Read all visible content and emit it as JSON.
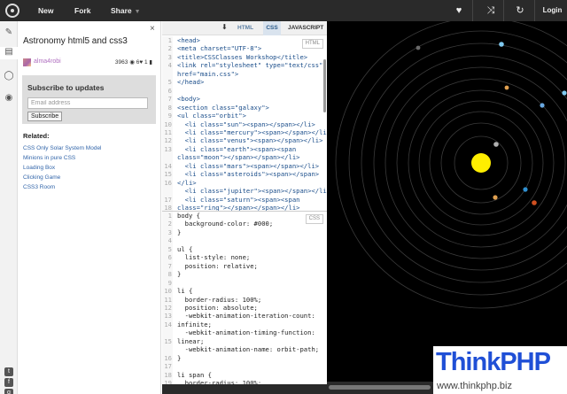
{
  "toolbar": {
    "new_label": "New",
    "fork_label": "Fork",
    "share_label": "Share",
    "share_caret": "▼",
    "login_label": "Login",
    "icons": [
      "logo-icon",
      "heart-icon",
      "shuffle-icon",
      "refresh-icon"
    ]
  },
  "strip": {
    "icons": [
      "wrench-icon",
      "document-icon",
      "comments-icon",
      "lightbulb-icon",
      "twitter-icon",
      "facebook-icon",
      "google-plus-icon"
    ]
  },
  "panel": {
    "close_label": "×",
    "title": "Astronomy html5 and css3",
    "author": "alma4robi",
    "views": "3963",
    "views_icon": "◉",
    "likes": "6",
    "likes_icon": "♥",
    "comments": "1",
    "comments_icon": "▮",
    "subscribe": {
      "title": "Subscribe to updates",
      "email_placeholder": "Email address",
      "button_label": "Subscribe"
    },
    "related_title": "Related:",
    "related": [
      "CSS Only Solar System Model",
      "Minions in pure CSS",
      "Loading Box",
      "Clicking Game",
      "CSS3 Room"
    ]
  },
  "editor": {
    "arrow_label": "⬇",
    "tabs": [
      "HTML",
      "CSS",
      "JAVASCRIPT"
    ],
    "active_tab": "CSS",
    "html_pane_label": "HTML",
    "css_pane_label": "CSS",
    "html_line_numbers": "1\n2\n3\n4\n\n5\n6\n7\n8\n9\n10\n11\n12\n13\n\n14\n15\n16\n\n17\n18\n19\n",
    "html_code_lines": [
      "<head>",
      "<meta charset=\"UTF-8\">",
      "<title>CSSClasses Workshop</title>",
      "<link rel=\"stylesheet\" type=\"text/css\"",
      "href=\"main.css\">",
      "</head>",
      "",
      "<body>",
      "<section class=\"galaxy\">",
      "<ul class=\"orbit\">",
      "  <li class=\"sun\"><span></span></li>",
      "  <li class=\"mercury\"><span></span></li>",
      "  <li class=\"venus\"><span></span></li>",
      "  <li class=\"earth\"><span><span",
      "class=\"moon\"></span></span></li>",
      "  <li class=\"mars\"><span></span></li>",
      "  <li class=\"asteroids\"><span></span>",
      "</li>",
      "  <li class=\"jupiter\"><span></span></li>",
      "  <li class=\"saturn\"><span><span",
      "class=\"ring\"></span></span></li>"
    ],
    "css_line_numbers": "1\n2\n3\n4\n5\n6\n7\n8\n9\n10\n11\n12\n13\n14\n\n15\n\n16\n17\n18\n19\n20\n",
    "css_code_lines": [
      "body {",
      "  background-color: #000;",
      "}",
      "",
      "ul {",
      "  list-style: none;",
      "  position: relative;",
      "}",
      "",
      "li {",
      "  border-radius: 100%;",
      "  position: absolute;",
      "  -webkit-animation-iteration-count:",
      "infinite;",
      "  -webkit-animation-timing-function:",
      "linear;",
      "  -webkit-animation-name: orbit-path;",
      "}",
      "",
      "li span {",
      "  border-radius: 100%;"
    ]
  },
  "watermark": {
    "brand_a": "Think",
    "brand_b": "PHP",
    "url": "www.thinkphp.biz"
  },
  "colors": {
    "topbar": "#2a2a2a",
    "link": "#3366aa",
    "author": "#b070c0",
    "sun": "#ffee00",
    "stage": "#000000",
    "brand": "#1f4fd6"
  }
}
